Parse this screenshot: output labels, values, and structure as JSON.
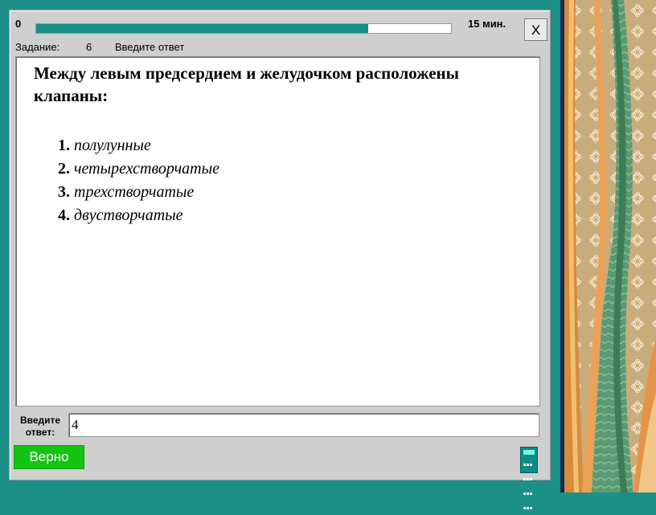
{
  "header": {
    "progress_start": "0",
    "progress_fraction": 0.8,
    "time_left": "15 мин.",
    "close_label": "X"
  },
  "task": {
    "label": "Задание:",
    "number": "6",
    "instruction": "Введите ответ"
  },
  "question": {
    "text": "Между левым предсердием и желудочком расположены клапаны:",
    "options": [
      {
        "num": "1.",
        "text": "полулунные"
      },
      {
        "num": "2.",
        "text": "четырехстворчатые"
      },
      {
        "num": "3.",
        "text": "трехстворчатые"
      },
      {
        "num": "4.",
        "text": "двустворчатые"
      }
    ]
  },
  "answer": {
    "label_line1": "Введите",
    "label_line2": "ответ:",
    "value": "4"
  },
  "result": {
    "label": "Верно",
    "color": "#13c413"
  },
  "icons": [
    "close-icon",
    "calculator-icon"
  ],
  "colors": {
    "frame": "#1c8f87",
    "progress": "#168f88"
  }
}
